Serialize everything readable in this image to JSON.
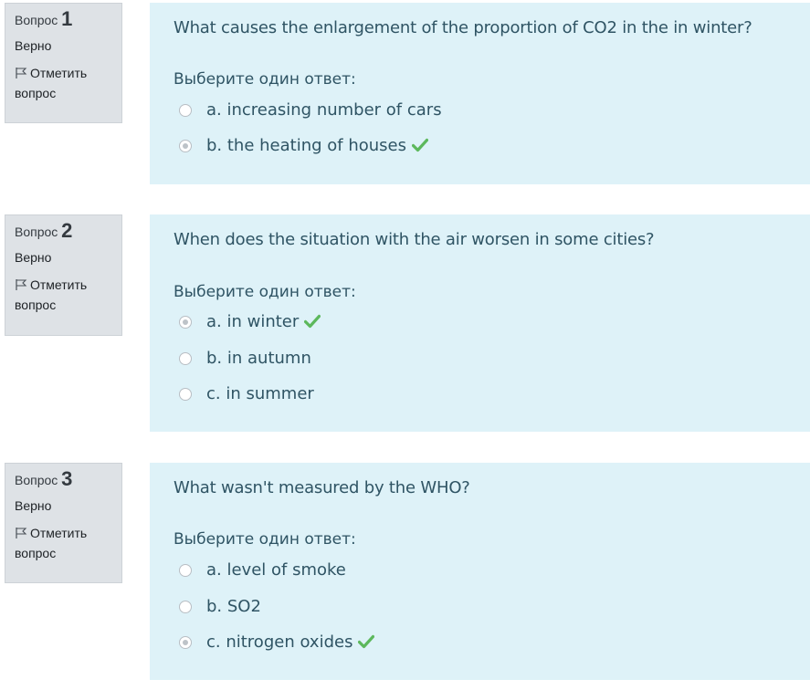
{
  "questions": [
    {
      "label": "Вопрос",
      "number": "1",
      "state": "Верно",
      "flag": "Отметить вопрос",
      "text": "What causes the enlargement of the proportion of CO2 in the in winter?",
      "prompt": "Выберите один ответ:",
      "answers": [
        {
          "text": "a. increasing number of cars",
          "selected": false,
          "correct": false
        },
        {
          "text": "b. the heating of houses",
          "selected": true,
          "correct": true
        }
      ]
    },
    {
      "label": "Вопрос",
      "number": "2",
      "state": "Верно",
      "flag": "Отметить вопрос",
      "text": "When does the situation with the air worsen in some cities?",
      "prompt": "Выберите один ответ:",
      "answers": [
        {
          "text": "a. in winter",
          "selected": true,
          "correct": true
        },
        {
          "text": "b. in autumn",
          "selected": false,
          "correct": false
        },
        {
          "text": "c. in summer",
          "selected": false,
          "correct": false
        }
      ]
    },
    {
      "label": "Вопрос",
      "number": "3",
      "state": "Верно",
      "flag": "Отметить вопрос",
      "text": "What wasn't measured by the WHO?",
      "prompt": "Выберите один ответ:",
      "answers": [
        {
          "text": "a. level of smoke",
          "selected": false,
          "correct": false
        },
        {
          "text": "b. SO2",
          "selected": false,
          "correct": false
        },
        {
          "text": "c. nitrogen oxides",
          "selected": true,
          "correct": true
        }
      ]
    }
  ],
  "colors": {
    "info_bg": "#dee2e6",
    "content_bg": "#def2f8",
    "text": "#2f5464",
    "correct_check": "#5cb85c"
  }
}
